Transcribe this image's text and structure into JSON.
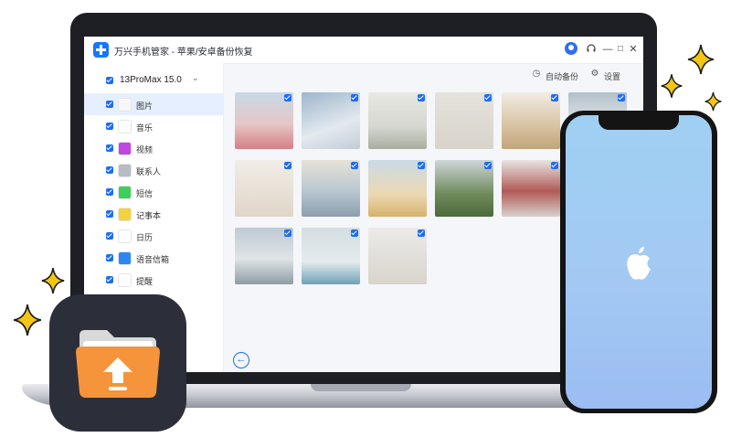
{
  "app": {
    "title": "万兴手机管家 - 苹果/安卓备份恢复",
    "window_controls": [
      "—",
      "□",
      "✕"
    ]
  },
  "sidebar": {
    "device": "13ProMax 15.0",
    "items": [
      {
        "label": "图片",
        "icon": "photos-icon",
        "color": "#f7f7f7",
        "active": true
      },
      {
        "label": "音乐",
        "icon": "music-icon",
        "color": "#ffffff",
        "active": false
      },
      {
        "label": "视频",
        "icon": "video-icon",
        "color": "#c246e0",
        "active": false
      },
      {
        "label": "联系人",
        "icon": "contacts-icon",
        "color": "#b8bcc4",
        "active": false
      },
      {
        "label": "短信",
        "icon": "messages-icon",
        "color": "#3ecf5a",
        "active": false
      },
      {
        "label": "记事本",
        "icon": "notes-icon",
        "color": "#f6d23e",
        "active": false
      },
      {
        "label": "日历",
        "icon": "calendar-icon",
        "color": "#ffffff",
        "active": false
      },
      {
        "label": "语音信箱",
        "icon": "voicemail-icon",
        "color": "#2d86f5",
        "active": false
      },
      {
        "label": "提醒",
        "icon": "reminders-icon",
        "color": "#ffffff",
        "active": false
      }
    ]
  },
  "toolbar": {
    "auto_backup": "自动备份",
    "settings": "设置"
  },
  "photos": [
    {
      "caption": "",
      "bg": "linear-gradient(180deg,#c7d9e7 0%,#e6c7c7 55%,#d67f86 100%)"
    },
    {
      "caption": "",
      "bg": "linear-gradient(160deg,#9db6cc 0%,#e3e9ef 60%,#c3ccd6 100%)"
    },
    {
      "caption": "",
      "bg": "linear-gradient(180deg,#e9e8e3 0%,#d5d7d0 60%,#a9ad9f 100%)"
    },
    {
      "caption": "",
      "bg": "linear-gradient(180deg,#e4e2dc 0%,#d8d4cb 100%)"
    },
    {
      "caption": "",
      "bg": "linear-gradient(180deg,#f1ece4 0%,#d7c2a1 60%,#c2a57b 100%)"
    },
    {
      "caption": "",
      "bg": "linear-gradient(180deg,#b3c0ca 0%,#e0e5e8 55%,#a4b1bb 100%)"
    },
    {
      "caption": "",
      "bg": "linear-gradient(180deg,#f1ede6 0%,#dfd6c8 100%)"
    },
    {
      "caption": "",
      "bg": "linear-gradient(180deg,#e8e2d7 0%,#b8c7d0 55%,#8c9fae 100%)"
    },
    {
      "caption": "",
      "bg": "linear-gradient(180deg,#c9dbe6 0%,#ecd9b3 60%,#d6b26b 100%)"
    },
    {
      "caption": "",
      "bg": "linear-gradient(180deg,#cfd6d9 0%,#6f8a5b 60%,#4d6a3c 100%)"
    },
    {
      "caption": "",
      "bg": "linear-gradient(180deg,#e7e5e3 0%,#b25a55 55%,#d8d1cc 100%)"
    },
    {
      "caption": "",
      "bg": "linear-gradient(180deg,#bfcad3 0%,#dfe4e7 55%,#8e9ca4 100%)"
    },
    {
      "caption": "",
      "bg": "linear-gradient(180deg,#d5dee3 0%,#e4ebee 60%,#6fa1b6 100%)"
    },
    {
      "caption": "",
      "bg": "linear-gradient(180deg,#ecebe8 0%,#d8d4cc 100%)"
    }
  ],
  "phone": {
    "screen_color": "#a3c9f3"
  },
  "brand": {
    "accent": "#1c6df2",
    "icon_orange": "#f5943a",
    "sparkle": "#f4c614"
  }
}
